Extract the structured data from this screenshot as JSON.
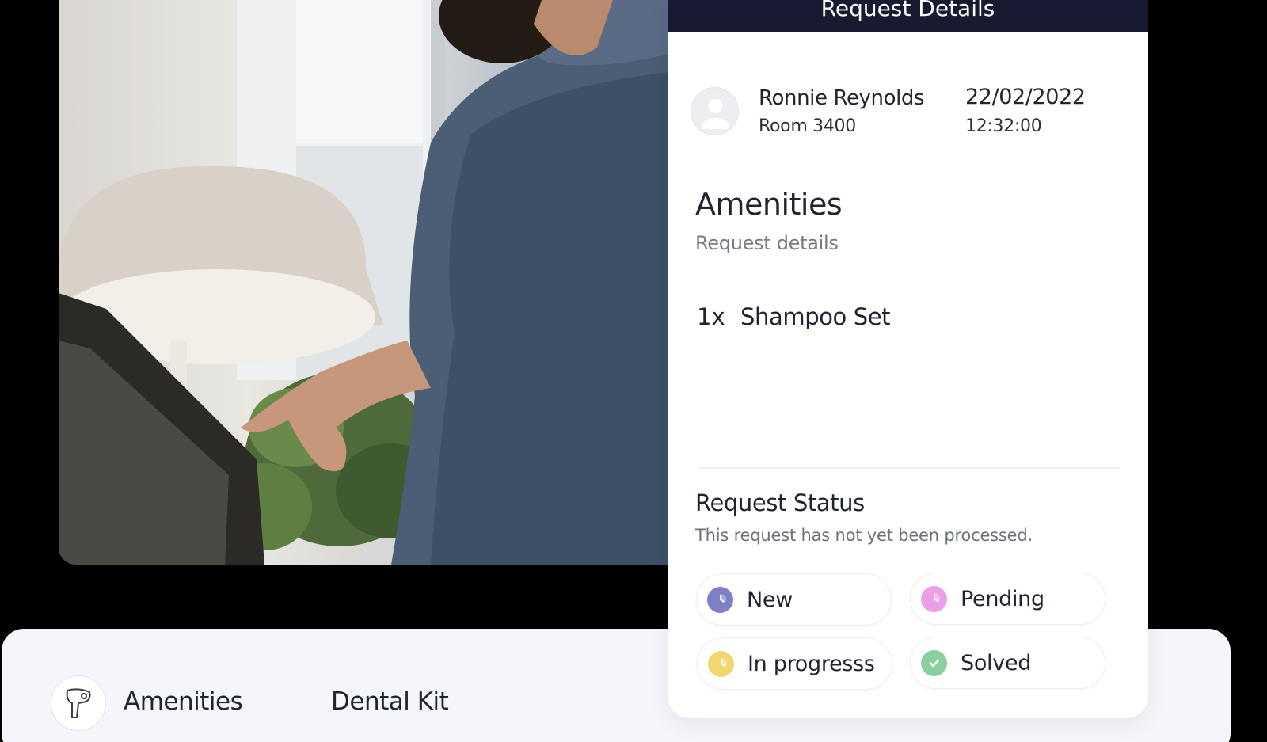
{
  "panel": {
    "title": "Request Details",
    "guest": {
      "name": "Ronnie Reynolds",
      "room": "Room 3400",
      "date": "22/02/2022",
      "time": "12:32:00"
    },
    "category": {
      "title": "Amenities",
      "subtitle": "Request details"
    },
    "items": [
      {
        "qty": "1x",
        "name": "Shampoo Set"
      }
    ],
    "status": {
      "title": "Request Status",
      "message": "This request has not yet been processed.",
      "options": [
        {
          "label": "New",
          "color": "#7f7fc9",
          "icon": "clock-icon"
        },
        {
          "label": "Pending",
          "color": "#ea9fe6",
          "icon": "clock-icon"
        },
        {
          "label": "In progresss",
          "color": "#f0d772",
          "icon": "clock-icon"
        },
        {
          "label": "Solved",
          "color": "#8ad09e",
          "icon": "check-icon"
        }
      ]
    }
  },
  "bottom_list": {
    "icon": "hair-dryer-icon",
    "category_label": "Amenities",
    "item_label": "Dental Kit"
  },
  "colors": {
    "header_bg": "#171a30",
    "panel_bg": "#ffffff",
    "bottom_card_bg": "#f5f6fb",
    "page_bg": "#000000"
  }
}
